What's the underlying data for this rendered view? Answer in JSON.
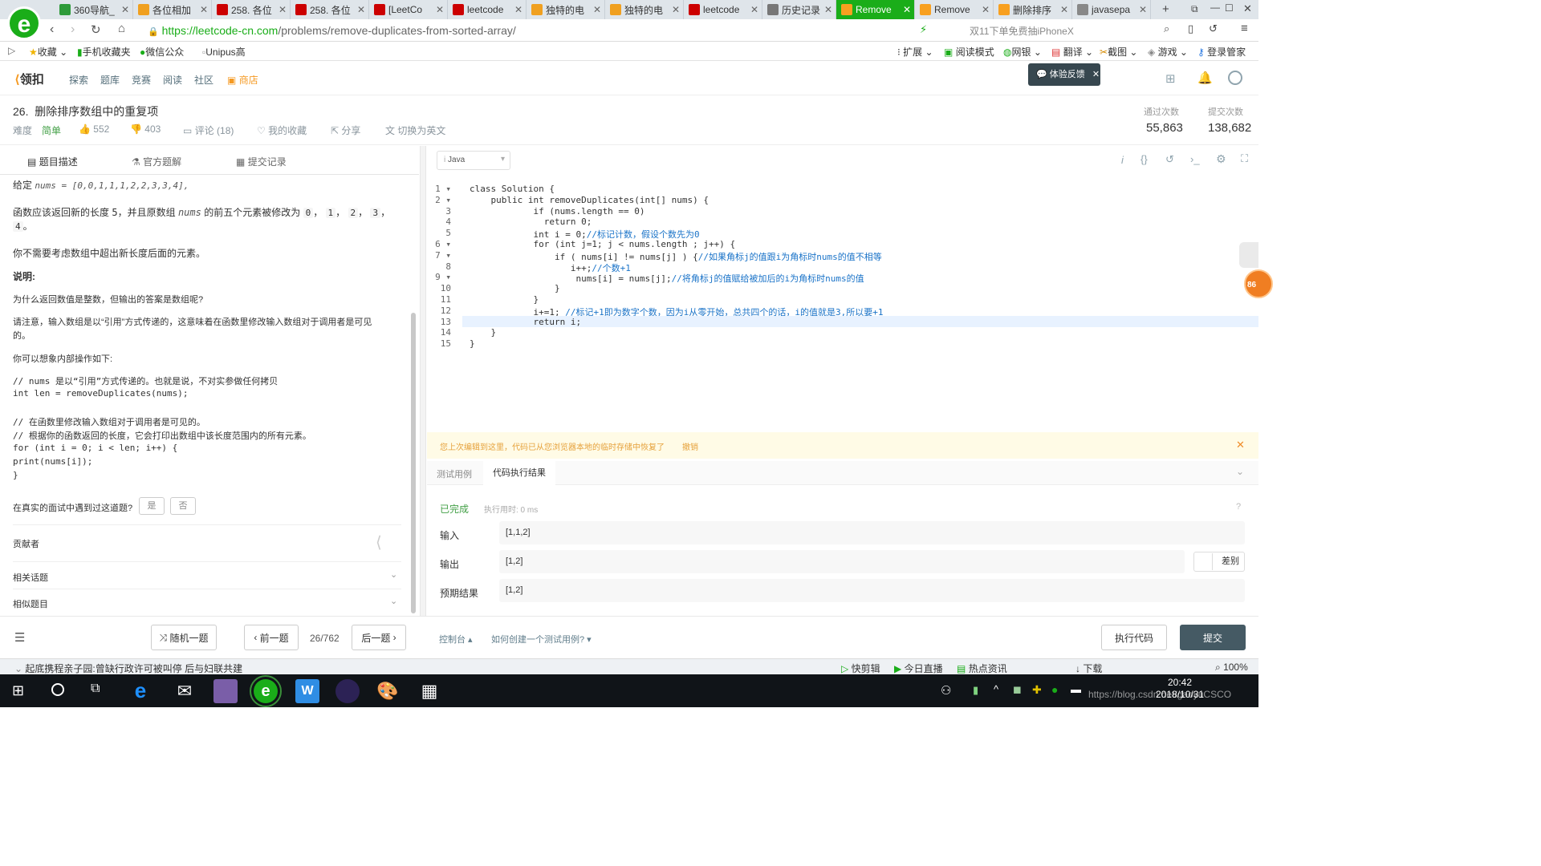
{
  "browser": {
    "tabs": [
      {
        "label": "360导航_",
        "color": "#2e9a3a"
      },
      {
        "label": "各位相加",
        "color": "#f0a020"
      },
      {
        "label": "258. 各位",
        "color": "#c00"
      },
      {
        "label": "258. 各位",
        "color": "#c00"
      },
      {
        "label": "[LeetCo",
        "color": "#c00"
      },
      {
        "label": "leetcode",
        "color": "#c00"
      },
      {
        "label": "独特的电",
        "color": "#f0a020"
      },
      {
        "label": "独特的电",
        "color": "#f0a020"
      },
      {
        "label": "leetcode",
        "color": "#c00"
      },
      {
        "label": "历史记录",
        "color": "#777"
      },
      {
        "label": "Remove",
        "color": "#f8a020",
        "active": true
      },
      {
        "label": "Remove",
        "color": "#f8a020"
      },
      {
        "label": "删除排序",
        "color": "#f8a020"
      },
      {
        "label": "javasepa",
        "color": "#888"
      }
    ],
    "url_prefix": "https://",
    "url_domain": "leetcode-cn.com",
    "url_path": "/problems/remove-duplicates-from-sorted-array/",
    "search_text": "双11下单免费抽iPhoneX",
    "bookmarks_left": [
      "收藏",
      "手机收藏夹",
      "微信公众",
      "Unipus高"
    ],
    "bookmarks_right": [
      "扩展",
      "阅读模式",
      "网银",
      "翻译",
      "截图",
      "游戏",
      "登录管家"
    ]
  },
  "site": {
    "logo": "领扣",
    "nav": [
      "探索",
      "题库",
      "竞赛",
      "阅读",
      "社区",
      "商店"
    ],
    "feedback": "体验反馈"
  },
  "problem": {
    "title": "26.  删除排序数组中的重复项",
    "difficulty_label": "难度",
    "difficulty": "简单",
    "likes": "552",
    "dislikes": "403",
    "comments": "评论 (18)",
    "favorite": "我的收藏",
    "share": "分享",
    "switch_lang": "切换为英文",
    "accepted_label": "通过次数",
    "accepted": "55,863",
    "submissions_label": "提交次数",
    "submissions": "138,682"
  },
  "left_tabs": [
    "题目描述",
    "官方题解",
    "提交记录"
  ],
  "description": {
    "l1a": "给定",
    "l1b": "nums = [0,0,1,1,1,2,2,3,3,4],",
    "l2a": "函数应该返回新的长度",
    "l2b": "5",
    "l2c": "，并且原数组",
    "l2d": "nums",
    "l2e": "的前五个元素被修改为",
    "vals": [
      "0",
      "1",
      "2",
      "3",
      "4"
    ],
    "l4": "你不需要考虑数组中超出新长度后面的元素。",
    "note_title": "说明:",
    "q": "为什么返回数值是整数，但输出的答案是数组呢?",
    "p1": "请注意，输入数组是以“引用”方式传递的，这意味着在函数里修改输入数组对于调用者是可见",
    "p1b": "的。",
    "p2": "你可以想象内部操作如下:",
    "code": [
      "// nums 是以“引用”方式传递的。也就是说，不对实参做任何拷贝",
      "int len = removeDuplicates(nums);",
      "",
      "// 在函数里修改输入数组对于调用者是可见的。",
      "// 根据你的函数返回的长度，它会打印出数组中该长度范围内的所有元素。",
      "for (int i = 0; i < len; i++) {",
      "    print(nums[i]);",
      "}"
    ],
    "interview_q": "在真实的面试中遇到过这道题?",
    "yes": "是",
    "no": "否",
    "contributors": "贡献者",
    "related": "相关话题",
    "similar": "相似题目"
  },
  "editor": {
    "language": "Java",
    "lines": [
      "class Solution {",
      "    public int removeDuplicates(int[] nums) {",
      "            if (nums.length == 0)",
      "              return 0;",
      "            int i = 0;//标记计数，假设个数先为0",
      "            for (int j=1; j < nums.length ; j++) {",
      "                if ( nums[i] != nums[j] ) {//如果角标j的值跟i为角标时nums的值不相等",
      "                   i++;//个数+1",
      "                    nums[i] = nums[j];//将角标j的值赋给被加后的i为角标时nums的值",
      "                }",
      "            }",
      "            i+=1; //标记+1即为数字个数，因为i从零开始，总共四个的话，i的值就是3,所以要+1",
      "            return i;",
      "    }",
      "}"
    ]
  },
  "notice": {
    "text": "您上次编辑到这里，代码已从您浏览器本地的临时存储中恢复了",
    "undo": "撤销"
  },
  "result": {
    "tabs": [
      "测试用例",
      "代码执行结果"
    ],
    "status": "已完成",
    "runtime": "执行用时: 0 ms",
    "input_label": "输入",
    "input": "[1,1,2]",
    "output_label": "输出",
    "output": "[1,2]",
    "diff": "差别",
    "expected_label": "预期结果",
    "expected": "[1,2]"
  },
  "actions": {
    "random": "随机一题",
    "prev": "前一题",
    "page": "26/762",
    "next": "后一题",
    "console": "控制台",
    "howto": "如何创建一个测试用例?",
    "run": "执行代码",
    "submit": "提交"
  },
  "statusbar": {
    "news": "起底携程亲子园:曾缺行政许可被叫停 后与妇联共建",
    "items": [
      "快剪辑",
      "今日直播",
      "热点资讯",
      "下载",
      "100%"
    ]
  },
  "taskbar": {
    "time": "20:42",
    "date": "2018/10/31",
    "watermark": "https://blog.csdn.net/gaoyuCSCO",
    "badge": "86"
  }
}
